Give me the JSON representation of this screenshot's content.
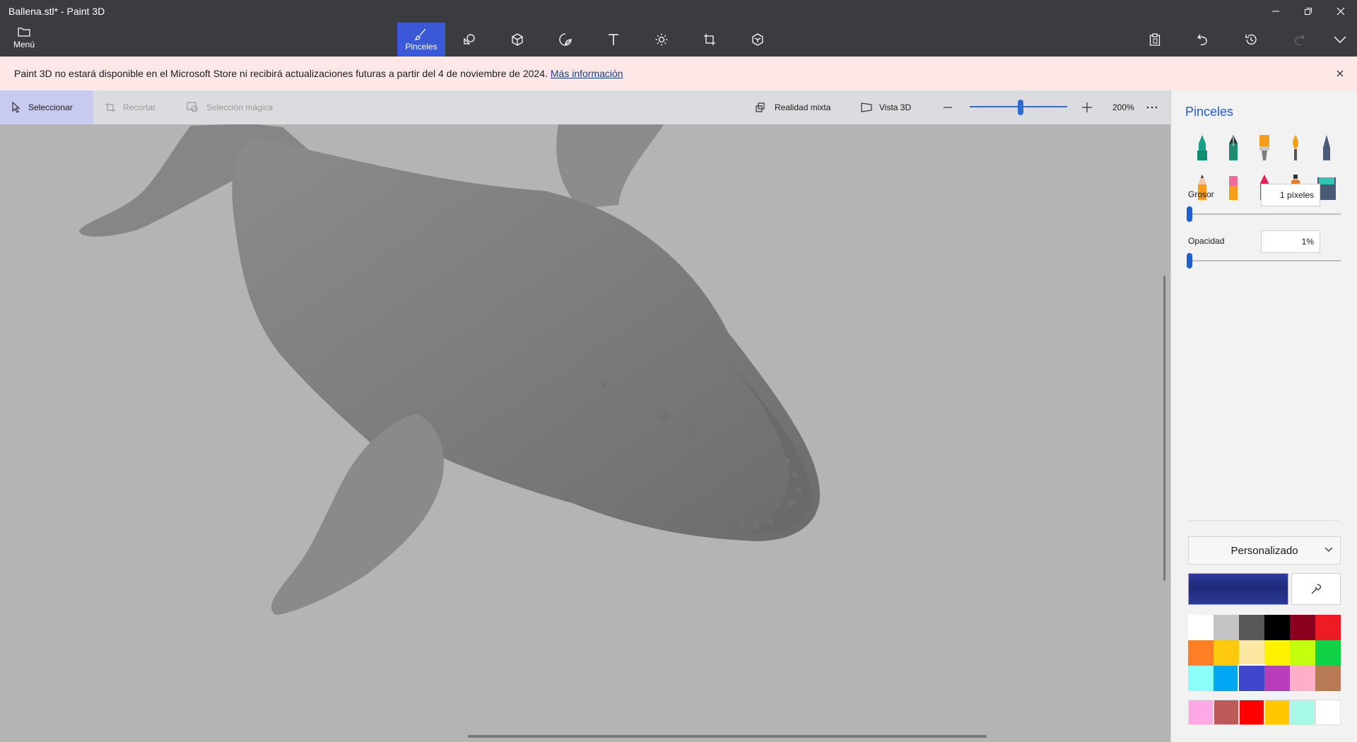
{
  "window": {
    "title": "Ballena.stl* - Paint 3D"
  },
  "appbar": {
    "menu_label": "Menú",
    "tools": [
      {
        "name": "brushes",
        "label": "Pinceles",
        "icon": "brush-icon",
        "active": true
      },
      {
        "name": "2d-shapes",
        "icon": "2d-shapes-icon"
      },
      {
        "name": "3d-shapes",
        "icon": "3d-cube-icon"
      },
      {
        "name": "stickers",
        "icon": "sticker-icon"
      },
      {
        "name": "text",
        "icon": "text-icon"
      },
      {
        "name": "effects",
        "icon": "sun-effects-icon"
      },
      {
        "name": "canvas",
        "icon": "canvas-crop-icon"
      },
      {
        "name": "3d-library",
        "icon": "3d-library-icon"
      }
    ],
    "right_tools": [
      "paste-icon",
      "undo-icon",
      "history-icon",
      "redo-icon",
      "expand-icon"
    ]
  },
  "banner": {
    "text": "Paint 3D no estará disponible en el Microsoft Store ni recibirá actualizaciones futuras a partir del 4 de noviembre de 2024.",
    "link": "Más información"
  },
  "toolbar2": {
    "select_label": "Seleccionar",
    "crop_label": "Recortar",
    "magic_select_label": "Selección mágica",
    "mixed_reality_label": "Realidad mixta",
    "view3d_label": "Vista 3D",
    "zoom_value": "200%"
  },
  "panel": {
    "title": "Pinceles",
    "thickness_label": "Grosor",
    "thickness_value": "1 píxeles",
    "opacity_label": "Opacidad",
    "opacity_value": "1%",
    "palette_label": "Personalizado",
    "current_color": "#2c3a9a",
    "brushes": [
      "marker-icon",
      "calligraphy-pen-icon",
      "oil-brush-icon",
      "watercolor-icon",
      "pixel-pen-icon",
      "pencil-icon",
      "eraser-icon",
      "crayon-icon",
      "spray-can-icon",
      "fill-bucket-icon"
    ],
    "colors": [
      "#ffffff",
      "#c3c3c3",
      "#585858",
      "#000000",
      "#88001b",
      "#ec1c24",
      "#ff7f27",
      "#ffc90e",
      "#fde8a2",
      "#fff200",
      "#c4ff0e",
      "#0ed145",
      "#8cfffb",
      "#00a8f3",
      "#3f48cc",
      "#b83dba",
      "#ffaec8",
      "#b97a56"
    ],
    "custom_colors": [
      "#ffa8e6",
      "#bb5a58",
      "#ff0000",
      "#ffc800",
      "#a6fbe6",
      "#ffffff"
    ]
  }
}
